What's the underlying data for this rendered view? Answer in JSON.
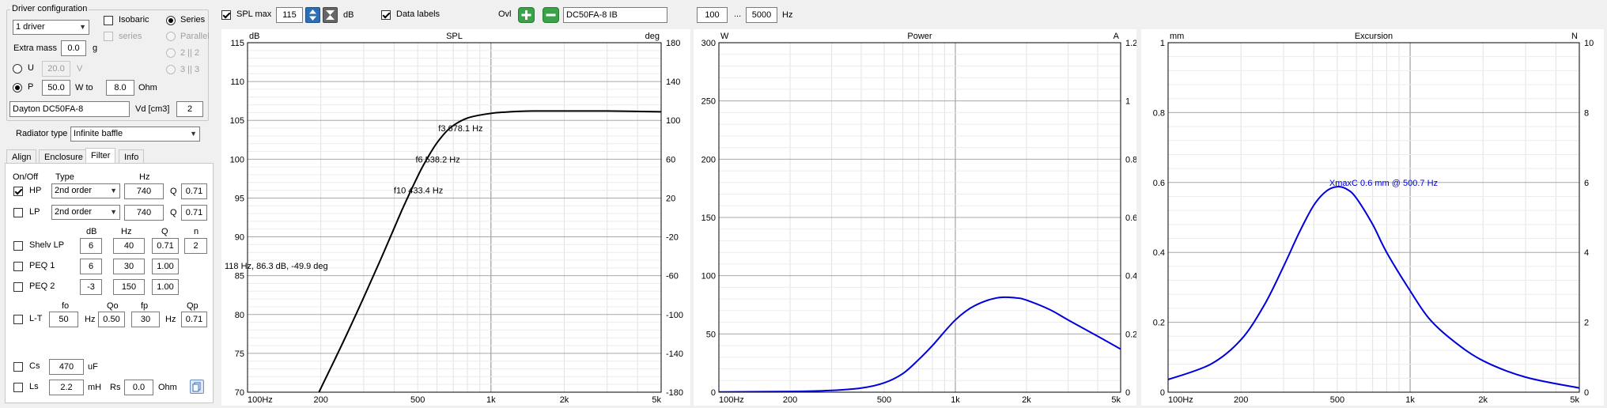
{
  "driver_config": {
    "title": "Driver configuration",
    "driver_count": "1 driver",
    "isobaric_label": "Isobaric",
    "series_label": "Series",
    "series2_label": "series",
    "parallel_label": "Parallel",
    "p22_label": "2 || 2",
    "p33_label": "3 || 3",
    "extra_mass_label": "Extra mass",
    "extra_mass_value": "0.0",
    "extra_mass_unit": "g",
    "u_label": "U",
    "u_value": "20.0",
    "u_unit": "V",
    "p_label": "P",
    "p_value": "50.0",
    "w_to_label": "W to",
    "ohm_value": "8.0",
    "ohm_unit": "Ohm",
    "driver_name": "Dayton DC50FA-8",
    "vd_label": "Vd [cm3]",
    "vd_value": "2"
  },
  "radiator": {
    "label": "Radiator type",
    "value": "Infinite baffle"
  },
  "tabs": [
    "Align",
    "Enclosure",
    "Filter",
    "Info"
  ],
  "filter": {
    "onoff_header": "On/Off",
    "type_header": "Type",
    "hz_header": "Hz",
    "hp": {
      "label": "HP",
      "type": "2nd order",
      "hz": "740",
      "q_label": "Q",
      "q": "0.71"
    },
    "lp": {
      "label": "LP",
      "type": "2nd order",
      "hz": "740",
      "q_label": "Q",
      "q": "0.71"
    },
    "cols": {
      "db": "dB",
      "hz": "Hz",
      "q": "Q",
      "n": "n"
    },
    "shelv": {
      "label": "Shelv LP",
      "db": "6",
      "hz": "40",
      "q": "0.71",
      "n": "2"
    },
    "peq1": {
      "label": "PEQ 1",
      "db": "6",
      "hz": "30",
      "q": "1.00"
    },
    "peq2": {
      "label": "PEQ 2",
      "db": "-3",
      "hz": "150",
      "q": "1.00"
    },
    "lt_cols": {
      "fo": "fo",
      "qo": "Qo",
      "fp": "fp",
      "qp": "Qp"
    },
    "lt": {
      "label": "L-T",
      "fo": "50",
      "hz1": "Hz",
      "qo": "0.50",
      "fp": "30",
      "hz2": "Hz",
      "qp": "0.71"
    },
    "cs": {
      "label": "Cs",
      "value": "470",
      "unit": "uF"
    },
    "ls": {
      "label": "Ls",
      "value": "2.2",
      "unit": "mH",
      "rs_label": "Rs",
      "rs_value": "0.0",
      "rs_unit": "Ohm"
    }
  },
  "toolbar": {
    "spl_max_label": "SPL max",
    "spl_max_value": "115",
    "db_unit": "dB",
    "data_labels_label": "Data labels",
    "ovl_label": "Ovl",
    "overlay_name": "DC50FA-8 IB",
    "freq_from": "100",
    "ellipsis": "...",
    "freq_to": "5000",
    "hz_unit": "Hz"
  },
  "colors": {
    "spl_curve": "#000000",
    "power_curve": "#0000dd",
    "excursion_curve": "#0000dd",
    "annotation": "#0000dd"
  },
  "chart_data": [
    {
      "type": "line",
      "title": "SPL",
      "y_unit_left": "dB",
      "y_unit_right": "deg",
      "x_ticks": [
        "100Hz",
        "200",
        "500",
        "1k",
        "2k",
        "5k"
      ],
      "y_ticks_left": [
        "115",
        "110",
        "105",
        "100",
        "95",
        "90",
        "85",
        "80",
        "75",
        "70"
      ],
      "y_ticks_right": [
        "180",
        "140",
        "100",
        "60",
        "20",
        "-20",
        "-60",
        "-100",
        "-140",
        "-180"
      ],
      "xlim": [
        100,
        5000
      ],
      "ylim": [
        70,
        115
      ],
      "x_scale": "log",
      "grid": true,
      "series": [
        {
          "x": [
            180,
            200,
            250,
            300,
            350,
            400,
            433,
            500,
            538,
            600,
            678,
            800,
            1000,
            1200,
            1500,
            2000,
            3000,
            5000
          ],
          "y": [
            67.5,
            70.5,
            76.8,
            82.2,
            86.9,
            91.1,
            93.6,
            97.8,
            99.7,
            102.1,
            104.0,
            105.3,
            105.9,
            106.1,
            106.2,
            106.2,
            106.2,
            106.1
          ]
        }
      ],
      "annotations": [
        "f3 678.1 Hz",
        "f6 538.2 Hz",
        "f10 433.4 Hz",
        "118 Hz, 86.3 dB, -49.9 deg"
      ]
    },
    {
      "type": "line",
      "title": "Power",
      "y_unit_left": "W",
      "y_unit_right": "A",
      "x_ticks": [
        "100Hz",
        "200",
        "500",
        "1k",
        "2k",
        "5k"
      ],
      "y_ticks_left": [
        "300",
        "250",
        "200",
        "150",
        "100",
        "50",
        "0"
      ],
      "y_ticks_right": [
        "1.2",
        "1",
        "0.8",
        "0.6",
        "0.4",
        "0.2",
        "0"
      ],
      "xlim": [
        100,
        5000
      ],
      "ylim": [
        0,
        300
      ],
      "x_scale": "log",
      "grid": true,
      "series": [
        {
          "x": [
            100,
            200,
            300,
            400,
            500,
            600,
            700,
            800,
            1000,
            1200,
            1500,
            1800,
            2000,
            2500,
            3000,
            4000,
            5000
          ],
          "y": [
            0.2,
            0.6,
            1.5,
            3.5,
            8,
            16,
            28,
            40,
            62,
            74,
            81,
            81,
            79,
            71,
            62,
            48,
            37
          ]
        }
      ]
    },
    {
      "type": "line",
      "title": "Excursion",
      "y_unit_left": "mm",
      "y_unit_right": "N",
      "x_ticks": [
        "100Hz",
        "200",
        "500",
        "1k",
        "2k",
        "5k"
      ],
      "y_ticks_left": [
        "1",
        "0.8",
        "0.6",
        "0.4",
        "0.2",
        "0"
      ],
      "y_ticks_right": [
        "10",
        "8",
        "6",
        "4",
        "2",
        "0"
      ],
      "xlim": [
        100,
        5000
      ],
      "ylim": [
        0,
        1
      ],
      "x_scale": "log",
      "grid": true,
      "series": [
        {
          "x": [
            100,
            150,
            200,
            250,
            300,
            350,
            400,
            450,
            500,
            550,
            600,
            700,
            800,
            1000,
            1200,
            1500,
            2000,
            3000,
            5000
          ],
          "y": [
            0.036,
            0.08,
            0.15,
            0.25,
            0.36,
            0.46,
            0.535,
            0.575,
            0.588,
            0.58,
            0.555,
            0.48,
            0.4,
            0.29,
            0.21,
            0.148,
            0.09,
            0.043,
            0.012
          ]
        }
      ],
      "annotations": [
        "XmaxC 0.6 mm  @ 500.7 Hz"
      ]
    }
  ]
}
